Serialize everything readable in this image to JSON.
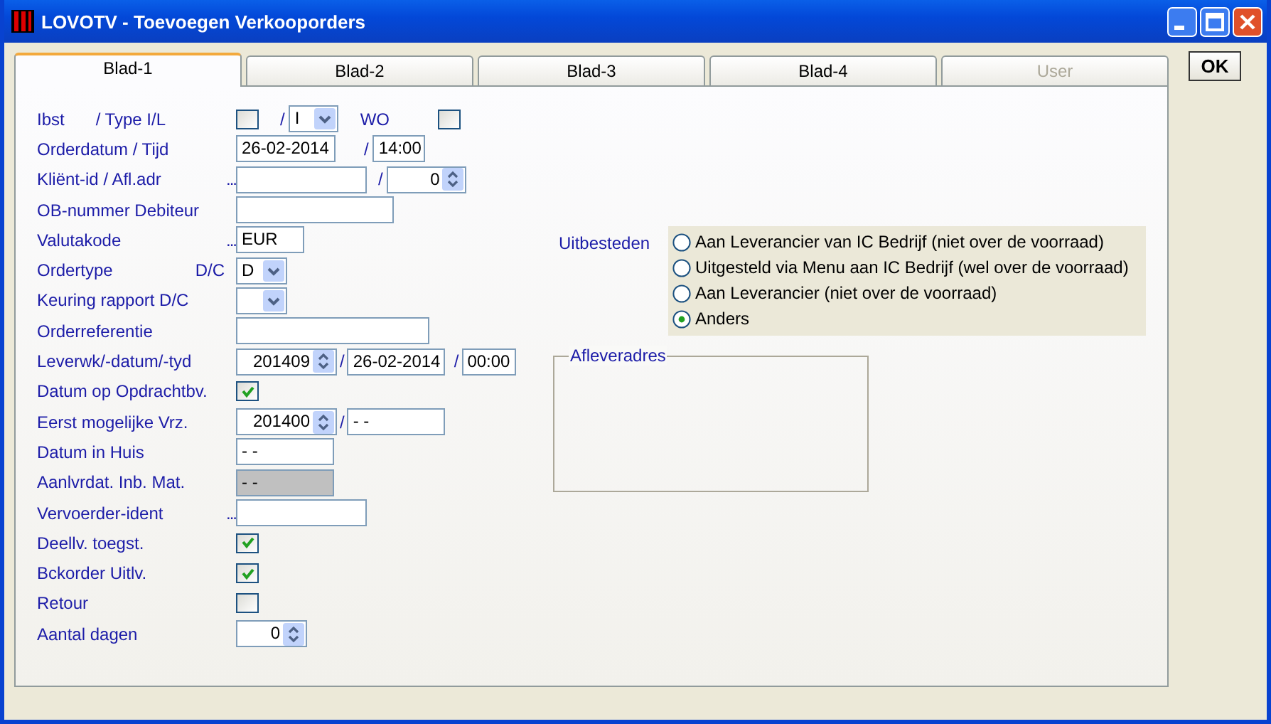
{
  "window": {
    "title": "LOVOTV - Toevoegen Verkooporders"
  },
  "tabs": [
    {
      "label": "Blad-1",
      "selected": true,
      "disabled": false
    },
    {
      "label": "Blad-2",
      "selected": false,
      "disabled": false
    },
    {
      "label": "Blad-3",
      "selected": false,
      "disabled": false
    },
    {
      "label": "Blad-4",
      "selected": false,
      "disabled": false
    },
    {
      "label": "User",
      "selected": false,
      "disabled": true
    }
  ],
  "ok_button": {
    "label": "OK"
  },
  "form_rows": [
    {
      "label": "Ibst",
      "sublabel": "/ Type I/L",
      "controls": [
        {
          "kind": "checkbox",
          "checked": false
        },
        {
          "kind": "sep",
          "text": "/"
        },
        {
          "kind": "select",
          "value": "I"
        },
        {
          "kind": "text",
          "text": "WO"
        },
        {
          "kind": "checkbox",
          "checked": false
        }
      ]
    },
    {
      "label": "Orderdatum / Tijd",
      "controls": [
        {
          "kind": "input",
          "value": "26-02-2014"
        },
        {
          "kind": "sep",
          "text": "/"
        },
        {
          "kind": "input",
          "value": "14:00"
        }
      ]
    },
    {
      "label": "Kliënt-id / Afl.adr",
      "lookup": "...",
      "controls": [
        {
          "kind": "input"
        },
        {
          "kind": "sep",
          "text": "/"
        },
        {
          "kind": "spin",
          "value": "0"
        }
      ]
    },
    {
      "label": "OB-nummer Debiteur",
      "controls": [
        {
          "kind": "input"
        }
      ]
    },
    {
      "label": "Valutakode",
      "lookup": "...",
      "controls": [
        {
          "kind": "input",
          "value": "EUR"
        }
      ]
    },
    {
      "label": "Ordertype",
      "sublabel": "D/C",
      "controls": [
        {
          "kind": "select",
          "value": "D"
        }
      ]
    },
    {
      "label": "Keuring rapport D/C",
      "controls": [
        {
          "kind": "select"
        }
      ]
    },
    {
      "label": "Orderreferentie",
      "controls": [
        {
          "kind": "input"
        }
      ]
    },
    {
      "label": "Leverwk/-datum/-tyd",
      "controls": [
        {
          "kind": "spin",
          "value": "201409"
        },
        {
          "kind": "sep",
          "text": "/"
        },
        {
          "kind": "input",
          "value": "26-02-2014"
        },
        {
          "kind": "sep",
          "text": "/"
        },
        {
          "kind": "input",
          "value": "00:00"
        }
      ]
    },
    {
      "label": "Datum op Opdrachtbv.",
      "controls": [
        {
          "kind": "checkbox",
          "checked": true
        }
      ]
    },
    {
      "label": "Eerst mogelijke Vrz.",
      "controls": [
        {
          "kind": "spin",
          "value": "201400"
        },
        {
          "kind": "sep",
          "text": "/"
        },
        {
          "kind": "input",
          "value": "- -"
        }
      ]
    },
    {
      "label": "Datum in Huis",
      "controls": [
        {
          "kind": "input",
          "value": "- -"
        }
      ]
    },
    {
      "label": "Aanlvrdat. Inb. Mat.",
      "controls": [
        {
          "kind": "input",
          "value": "- -",
          "disabled": true
        }
      ]
    },
    {
      "label": "Vervoerder-ident",
      "lookup": "...",
      "controls": [
        {
          "kind": "input"
        }
      ]
    },
    {
      "label": "Deellv. toegst.",
      "controls": [
        {
          "kind": "checkbox",
          "checked": true
        }
      ]
    },
    {
      "label": "Bckorder Uitlv.",
      "controls": [
        {
          "kind": "checkbox",
          "checked": true
        }
      ]
    },
    {
      "label": "Retour",
      "controls": [
        {
          "kind": "checkbox",
          "checked": false
        }
      ]
    },
    {
      "label": "Aantal dagen",
      "controls": [
        {
          "kind": "spin",
          "value": "0"
        }
      ]
    }
  ],
  "outsourcing": {
    "label": "Uitbesteden",
    "options": [
      {
        "label": "Aan Leverancier van IC Bedrijf (niet over de voorraad)",
        "selected": false
      },
      {
        "label": "Uitgesteld via Menu aan IC Bedrijf (wel over de voorraad)",
        "selected": false
      },
      {
        "label": "Aan Leverancier (niet over de voorraad)",
        "selected": false
      },
      {
        "label": "Anders",
        "selected": true
      }
    ]
  },
  "delivery_address": {
    "title": "Afleveradres"
  }
}
